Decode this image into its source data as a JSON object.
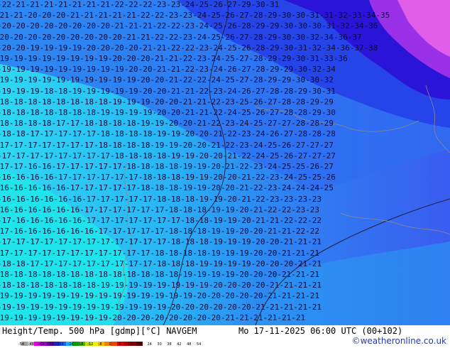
{
  "footer": {
    "title": "Height/Temp. 500 hPa [gdmp][°C] NAVGEM",
    "datetime": "Mo 17-11-2025 06:00 UTC (00+102)",
    "credit": "©weatheronline.co.uk"
  },
  "legend": {
    "ticks": [
      "-54",
      "-48",
      "-42",
      "-38",
      "-30",
      "-24",
      "-18",
      "-12",
      "-8",
      "0",
      "8",
      "12",
      "18",
      "24",
      "30",
      "38",
      "42",
      "48",
      "54"
    ],
    "colors": [
      "#a0a0a0",
      "#c8c8c8",
      "#e000e0",
      "#a000c0",
      "#7000a0",
      "#2020c0",
      "#2060ff",
      "#00c0ff",
      "#00a000",
      "#40c000",
      "#c0e000",
      "#f0f000",
      "#f0c000",
      "#f08000",
      "#f04000",
      "#e00000",
      "#b00000",
      "#800000",
      "#600000"
    ]
  },
  "map": {
    "rows": [
      "-22-21-21-21-21-21-21-21-22-22-22-23-23-24-25-26-27-29-30-31",
      "-21-21-20-20-20-21-21-21-21-21-22-22-23-23-24-25-26-27-28-29-30-30-31-31-32-33-34-35",
      "-20-20-20-20-20-20-20-20-21-21-21-22-22-23-24-25-26-28-29-29-30-30-30-31-32-34-36",
      "-20-20-20-20-20-20-20-20-20-21-21-22-22-23-24-25-26-27-28-29-30-30-32-34-36-37",
      "-20-20-19-19-19-19-20-20-20-20-21-21-22-22-23-24-25-26-28-29-30-31-32-34-36-37-38",
      "-19-19-19-19-19-19-19-19-20-20-20-21-21-22-23-24-25-27-28-29-29-30-31-33-36",
      "-19-19-19-19-19-19-19-19-19-20-20-21-21-22-23-24-26-27-28-29-29-30-32-34",
      "-19-19-19-19-19-19-19-19-19-19-20-20-21-22-22-24-25-27-28-29-29-30-30-32",
      "-19-19-19-18-18-19-19-19-19-19-20-20-21-21-22-23-24-26-27-28-28-29-30-31",
      "-18-18-18-18-18-18-18-18-19-19-19-20-20-21-21-22-23-25-26-27-28-28-29-29",
      "-18-18-18-18-18-18-18-19-19-19-19-20-20-21-21-22-24-25-26-27-28-28-29-30",
      "-18-18-18-18-17-17-18-18-18-18-19-19-20-20-21-22-23-24-25-27-27-28-28-29",
      "-18-18-17-17-17-17-17-18-18-18-18-19-19-20-20-21-22-23-24-26-27-28-28-28",
      "-17-17-17-17-17-17-17-18-18-18-18-19-19-20-20-21-22-23-24-25-26-27-27-27",
      "-17-17-17-17-17-17-17-17-18-18-18-18-19-19-20-20-21-22-24-25-26-27-27-27",
      "-17-17-16-16-17-17-17-17-17-18-18-18-18-19-19-20-21-22-23-24-25-25-26-27",
      "-16-16-16-16-17-17-17-17-17-17-18-18-18-19-19-20-20-21-22-23-24-25-25-26",
      "-16-16-16-16-16-17-17-17-17-17-18-18-18-19-19-20-20-21-22-23-24-24-24-25",
      "-16-16-16-16-16-16-17-17-17-17-17-18-18-18-19-19-20-21-22-23-23-23-23",
      "-16-16-16-16-16-16-17-17-17-17-17-17-18-18-18-19-19-20-21-22-22-23-23",
      "-17-16-16-16-16-16-17-17-17-17-17-17-17-18-18-19-19-20-21-21-22-22-22",
      "-17-16-16-16-16-16-16-17-17-17-17-17-18-18-18-19-19-20-20-21-21-22-22",
      "-17-17-17-17-17-17-17-17-17-17-17-17-18-18-18-19-19-19-20-20-21-21-21",
      "-17-17-17-17-17-17-17-17-17-17-17-18-18-18-18-19-19-19-20-20-21-21-21",
      "-18-18-17-17-17-17-17-17-17-17-17-18-18-18-19-19-19-19-20-20-20-21-21",
      "-18-18-18-18-18-18-18-18-18-18-18-18-18-19-19-19-19-20-20-20-21-21-21",
      "-18-18-18-18-18-18-18-19-19-19-19-19-19-19-19-20-20-20-20-21-21-21-21",
      "-19-19-19-19-19-19-19-19-19-19-19-19-19-19-20-20-20-20-20-21-21-21-21",
      "-19-19-19-19-19-19-19-19-19-19-19-19-20-20-20-20-20-20-21-21-21-21-21",
      "-19-19-19-19-19-19-19-19-20-20-20-20-20-20-20-20-21-21-21-21-21-21"
    ]
  }
}
